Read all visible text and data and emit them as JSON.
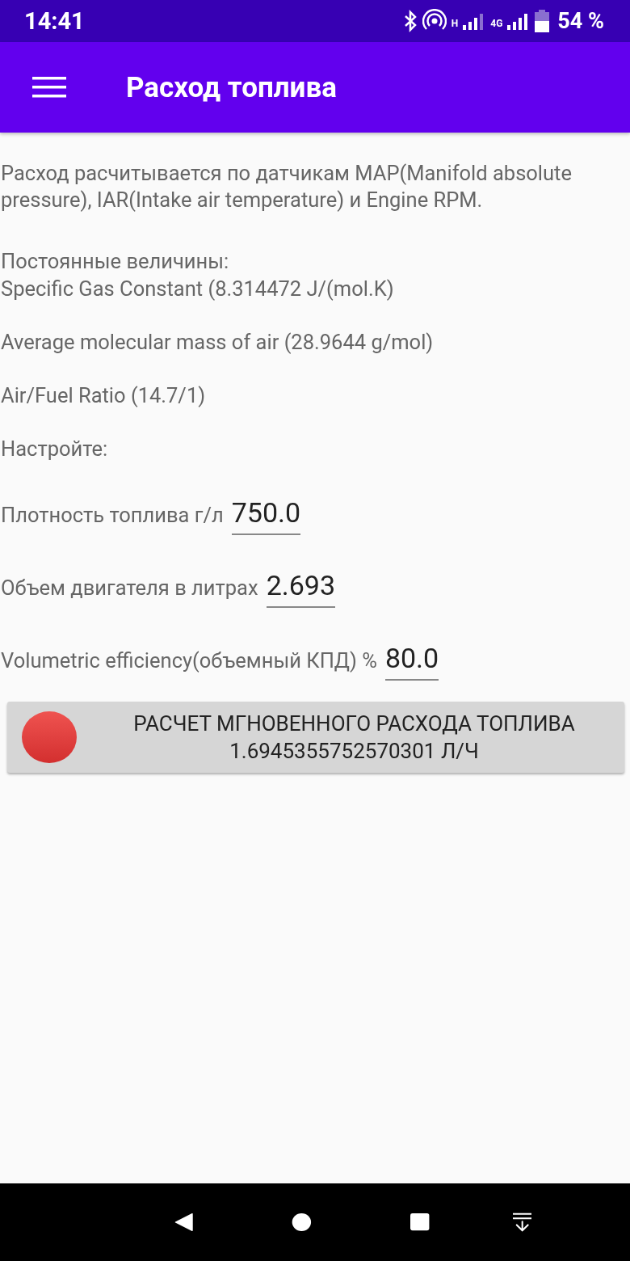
{
  "status_bar": {
    "time": "14:41",
    "network_1": "H",
    "network_2": "4G",
    "battery": "54 %"
  },
  "app_bar": {
    "title": "Расход топлива"
  },
  "description": "Расход расчитывается по датчикам MAP(Manifold absolute pressure), IAR(Intake air temperature) и Engine RPM.",
  "constants_heading": "Постоянные величины:",
  "constants": [
    "Specific Gas Constant (8.314472 J/(mol.K)",
    "Average molecular mass of air (28.9644 g/mol)",
    "Air/Fuel Ratio (14.7/1)"
  ],
  "settings_heading": "Настройте:",
  "fields": [
    {
      "label": "Плотность топлива г/л",
      "value": "750.0"
    },
    {
      "label": "Объем двигателя в литрах",
      "value": "2.693"
    },
    {
      "label": "Volumetric efficiency(объемный КПД) %",
      "value": "80.0"
    }
  ],
  "calc_button": {
    "label": "РАСЧЕТ МГНОВЕННОГО РАСХОДА ТОПЛИВА",
    "result": "1.6945355752570301 Л/Ч"
  }
}
